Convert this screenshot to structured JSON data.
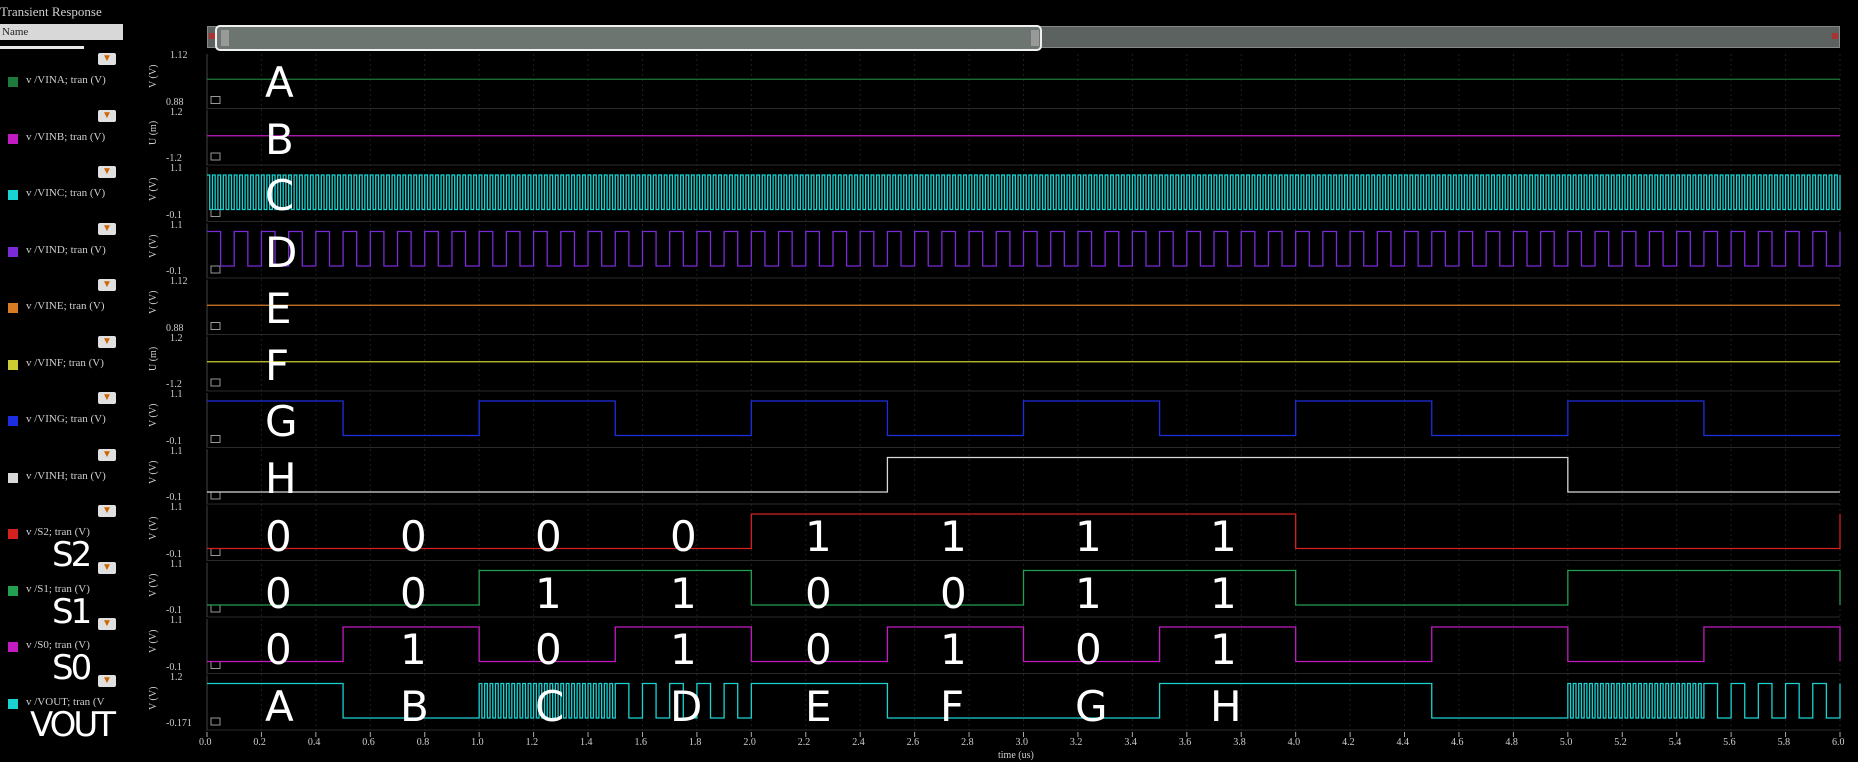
{
  "panel": {
    "title": "Transient Response",
    "name_field": "Name"
  },
  "colors": {
    "VINA": "#1e7a3a",
    "VINB": "#c21bc2",
    "VINC": "#19d3d3",
    "VIND": "#7a2ad6",
    "VINE": "#d77b24",
    "VINF": "#cccc33",
    "VING": "#1d2ee0",
    "VINH": "#d8d8d8",
    "S2": "#d52020",
    "S1": "#22a050",
    "S0": "#c21bc2",
    "VOUT": "#19d3d3"
  },
  "x_axis": {
    "ticks": [
      "0.0",
      "0.2",
      "0.4",
      "0.6",
      "0.8",
      "1.0",
      "1.2",
      "1.4",
      "1.6",
      "1.8",
      "2.0",
      "2.2",
      "2.4",
      "2.6",
      "2.8",
      "3.0",
      "3.2",
      "3.4",
      "3.6",
      "3.8",
      "4.0",
      "4.2",
      "4.4",
      "4.6",
      "4.8",
      "5.0",
      "5.2",
      "5.4",
      "5.6",
      "5.8",
      "6.0"
    ],
    "title": "time (us)"
  },
  "chart_data": [
    {
      "type": "line",
      "name": "v /VINA; tran (V)",
      "ylabel": "V (V)",
      "ymax": "1.12",
      "ymin": "0.88",
      "annotation": "A",
      "icon": "filter-icon",
      "signal": "constant",
      "value": 1.0
    },
    {
      "type": "line",
      "name": "v /VINB; tran (V)",
      "ylabel": "U (m)",
      "ymax": "1.2",
      "ymin": "-1.2",
      "annotation": "B",
      "icon": "filter-icon",
      "signal": "constant",
      "value": 0.0
    },
    {
      "type": "line",
      "name": "v /VINC; tran (V)",
      "ylabel": "V (V)",
      "ymax": "1.1",
      "ymin": "-0.1",
      "annotation": "C",
      "icon": "filter-icon",
      "signal": "clock",
      "period_us": 0.02
    },
    {
      "type": "line",
      "name": "v /VIND; tran (V)",
      "ylabel": "V (V)",
      "ymax": "1.1",
      "ymin": "-0.1",
      "annotation": "D",
      "icon": "filter-icon",
      "signal": "clock",
      "period_us": 0.1
    },
    {
      "type": "line",
      "name": "v /VINE; tran (V)",
      "ylabel": "V (V)",
      "ymax": "1.12",
      "ymin": "0.88",
      "annotation": "E",
      "icon": "filter-icon",
      "signal": "constant",
      "value": 1.0
    },
    {
      "type": "line",
      "name": "v /VINF; tran (V)",
      "ylabel": "U (m)",
      "ymax": "1.2",
      "ymin": "-1.2",
      "annotation": "F",
      "icon": "filter-icon",
      "signal": "constant",
      "value": 0.0
    },
    {
      "type": "line",
      "name": "v /VING; tran (V)",
      "ylabel": "V (V)",
      "ymax": "1.1",
      "ymin": "-0.1",
      "annotation": "G",
      "icon": "filter-icon",
      "signal": "clock",
      "period_us": 1.0
    },
    {
      "type": "line",
      "name": "v /VINH; tran (V)",
      "ylabel": "V (V)",
      "ymax": "1.1",
      "ymin": "-0.1",
      "annotation": "H",
      "icon": "filter-icon",
      "signal": "steps",
      "steps": [
        [
          0,
          0
        ],
        [
          2.5,
          1
        ],
        [
          5.0,
          0
        ]
      ]
    },
    {
      "type": "line",
      "name": "v /S2; tran (V)",
      "ylabel": "V (V)",
      "ymax": "1.1",
      "ymin": "-0.1",
      "annotation": "",
      "signal_label": "S2",
      "bits": [
        "0",
        "0",
        "0",
        "0",
        "1",
        "1",
        "1",
        "1"
      ],
      "signal": "steps",
      "steps": [
        [
          0,
          0
        ],
        [
          2.0,
          1
        ],
        [
          4.0,
          0
        ],
        [
          6.0,
          1
        ]
      ]
    },
    {
      "type": "line",
      "name": "v /S1; tran (V)",
      "ylabel": "V (V)",
      "ymax": "1.1",
      "ymin": "-0.1",
      "annotation": "",
      "signal_label": "S1",
      "bits": [
        "0",
        "0",
        "1",
        "1",
        "0",
        "0",
        "1",
        "1"
      ],
      "signal": "steps",
      "steps": [
        [
          0,
          0
        ],
        [
          1.0,
          1
        ],
        [
          2.0,
          0
        ],
        [
          3.0,
          1
        ],
        [
          4.0,
          0
        ],
        [
          5.0,
          1
        ],
        [
          6.0,
          0
        ]
      ]
    },
    {
      "type": "line",
      "name": "v /S0; tran (V)",
      "ylabel": "V (V)",
      "ymax": "1.1",
      "ymin": "-0.1",
      "annotation": "",
      "signal_label": "S0",
      "bits": [
        "0",
        "1",
        "0",
        "1",
        "0",
        "1",
        "0",
        "1"
      ],
      "signal": "steps",
      "steps": [
        [
          0,
          0
        ],
        [
          0.5,
          1
        ],
        [
          1.0,
          0
        ],
        [
          1.5,
          1
        ],
        [
          2.0,
          0
        ],
        [
          2.5,
          1
        ],
        [
          3.0,
          0
        ],
        [
          3.5,
          1
        ],
        [
          4.0,
          0
        ],
        [
          4.5,
          1
        ],
        [
          5.0,
          0
        ],
        [
          5.5,
          1
        ],
        [
          6.0,
          0
        ]
      ]
    },
    {
      "type": "line",
      "name": "v /VOUT; tran (V",
      "ylabel": "V (V)",
      "ymax": "1.2",
      "ymin": "-0.171",
      "annotation": "",
      "signal_label": "VOUT",
      "bits": [
        "A",
        "B",
        "C",
        "D",
        "E",
        "F",
        "G",
        "H"
      ],
      "signal": "vout"
    }
  ]
}
